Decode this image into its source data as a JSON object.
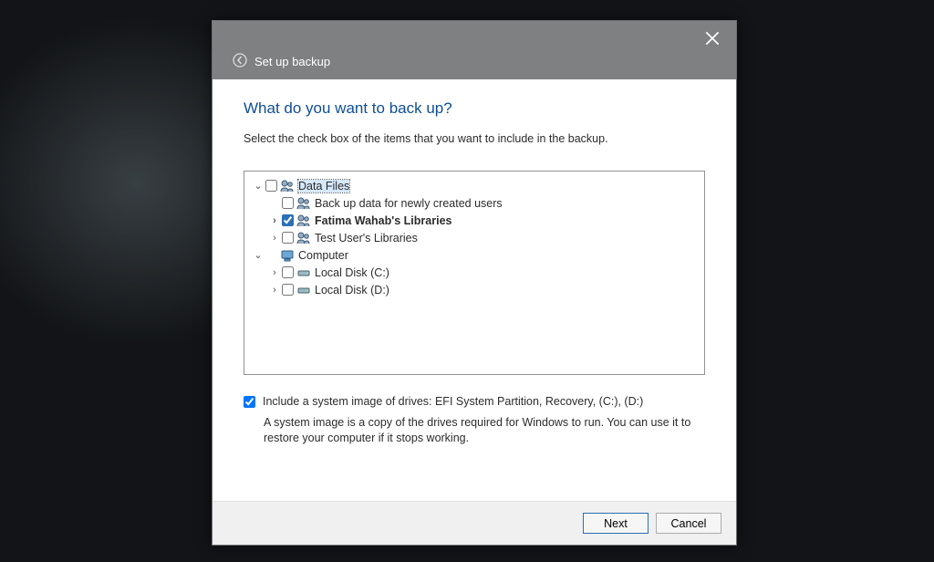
{
  "window": {
    "title": "Set up backup",
    "close_tooltip": "Close"
  },
  "heading": "What do you want to back up?",
  "instruction": "Select the check box of the items that you want to include in the backup.",
  "tree": [
    {
      "label": "Data Files",
      "icon": "users",
      "expanded": true,
      "selected": true,
      "checked": false,
      "bold": false,
      "children": [
        {
          "label": "Back up data for newly created users",
          "icon": "users",
          "expanded": null,
          "checked": false,
          "bold": false
        },
        {
          "label": "Fatima Wahab's Libraries",
          "icon": "users",
          "expanded": false,
          "checked": true,
          "bold": true
        },
        {
          "label": "Test User's Libraries",
          "icon": "users",
          "expanded": false,
          "checked": false,
          "bold": false
        }
      ]
    },
    {
      "label": "Computer",
      "icon": "computer",
      "expanded": true,
      "selected": false,
      "checked": null,
      "bold": false,
      "children": [
        {
          "label": "Local Disk (C:)",
          "icon": "drive",
          "expanded": false,
          "checked": false,
          "bold": false
        },
        {
          "label": "Local Disk (D:)",
          "icon": "drive",
          "expanded": false,
          "checked": false,
          "bold": false
        }
      ]
    }
  ],
  "system_image": {
    "checked": true,
    "label": "Include a system image of drives: EFI System Partition, Recovery, (C:), (D:)",
    "description": "A system image is a copy of the drives required for Windows to run. You can use it to restore your computer if it stops working."
  },
  "buttons": {
    "next": "Next",
    "cancel": "Cancel"
  }
}
